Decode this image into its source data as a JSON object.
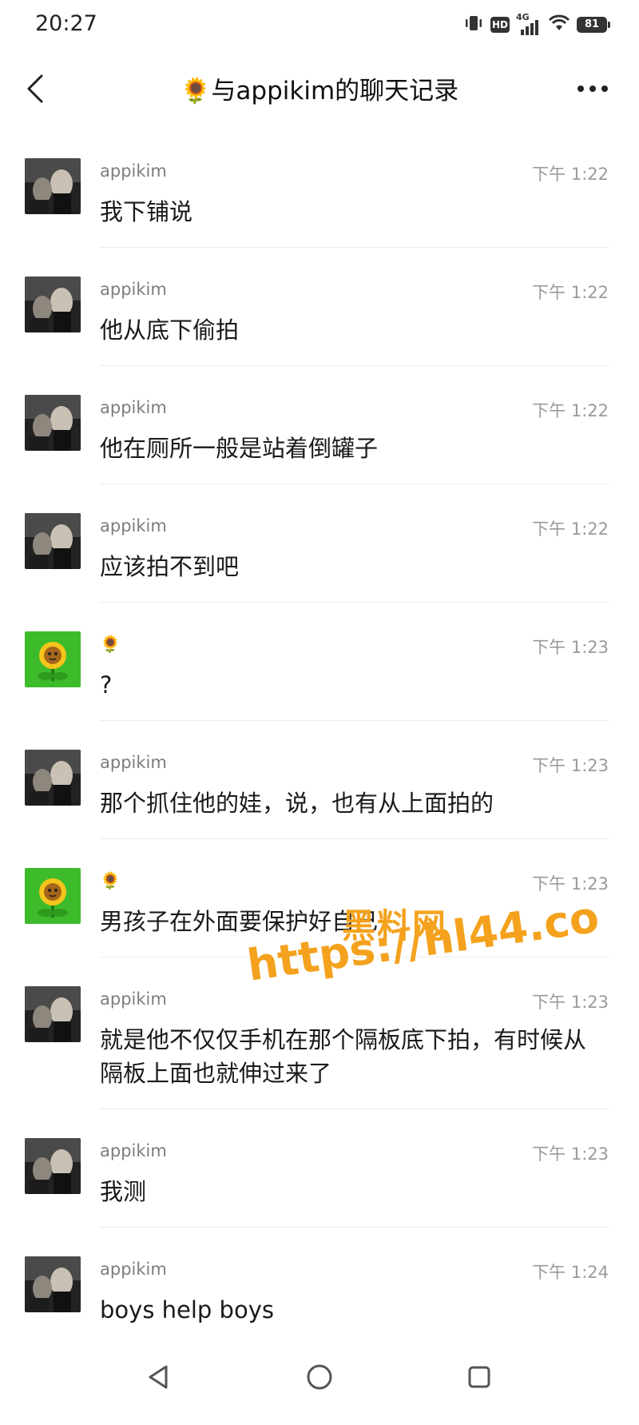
{
  "status_bar": {
    "time": "20:27",
    "network": "4G",
    "hd": "HD",
    "battery": "81"
  },
  "header": {
    "title": "🌻与appikim的聊天记录"
  },
  "messages": [
    {
      "sender": "appikim",
      "time": "下午 1:22",
      "text": "我下铺说",
      "avatar": "photo"
    },
    {
      "sender": "appikim",
      "time": "下午 1:22",
      "text": "他从底下偷拍",
      "avatar": "photo"
    },
    {
      "sender": "appikim",
      "time": "下午 1:22",
      "text": "他在厕所一般是站着倒罐子",
      "avatar": "photo"
    },
    {
      "sender": "appikim",
      "time": "下午 1:22",
      "text": "应该拍不到吧",
      "avatar": "photo"
    },
    {
      "sender": "🌻",
      "time": "下午 1:23",
      "text": "?",
      "avatar": "sunflower"
    },
    {
      "sender": "appikim",
      "time": "下午 1:23",
      "text": "那个抓住他的娃，说，也有从上面拍的",
      "avatar": "photo"
    },
    {
      "sender": "🌻",
      "time": "下午 1:23",
      "text": "男孩子在外面要保护好自己",
      "avatar": "sunflower"
    },
    {
      "sender": "appikim",
      "time": "下午 1:23",
      "text": "就是他不仅仅手机在那个隔板底下拍，有时候从隔板上面也就伸过来了",
      "avatar": "photo"
    },
    {
      "sender": "appikim",
      "time": "下午 1:23",
      "text": "我测",
      "avatar": "photo"
    },
    {
      "sender": "appikim",
      "time": "下午 1:24",
      "text": "boys help boys",
      "avatar": "photo"
    }
  ],
  "watermark": {
    "title": "黑料网",
    "url": "https://hl44.co"
  },
  "colors": {
    "watermark": "#f4a21e",
    "avatar_green": "#3dbb2b",
    "divider": "#ececec"
  }
}
